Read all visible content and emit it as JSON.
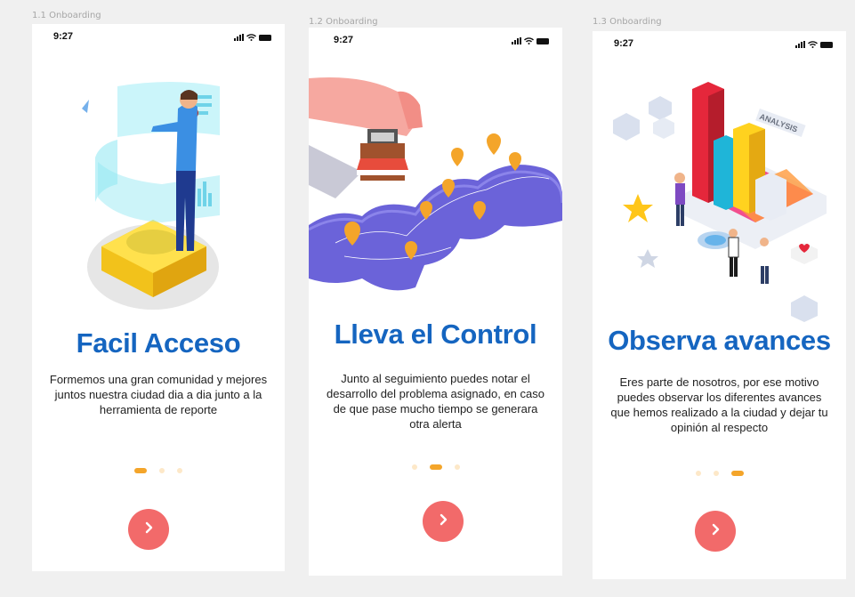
{
  "frames": [
    {
      "label": "1.1 Onboarding",
      "time": "9:27",
      "title": "Facil Acceso",
      "description": "Formemos una gran comunidad y mejores juntos nuestra ciudad dia a dia junto a la herramienta de reporte",
      "active_dot": 0,
      "next_icon": "chevron-right-icon"
    },
    {
      "label": "1.2 Onboarding",
      "time": "9:27",
      "title": "Lleva el Control",
      "description": "Junto al seguimiento puedes notar el desarrollo del problema asignado, en caso de que pase mucho tiempo se generara otra alerta",
      "active_dot": 1,
      "next_icon": "chevron-right-icon"
    },
    {
      "label": "1.3 Onboarding",
      "time": "9:27",
      "title": "Observa avances",
      "description": "Eres parte de nosotros, por ese motivo puedes observar los diferentes avances que hemos realizado a la ciudad y dejar tu opinión al respecto",
      "active_dot": 2,
      "next_icon": "chevron-right-icon",
      "illustration_text": "ANALYSIS"
    }
  ],
  "colors": {
    "title": "#1565c0",
    "button": "#f26a6a",
    "dot_active": "#f4a52a",
    "dot_inactive": "#fde8c8"
  }
}
